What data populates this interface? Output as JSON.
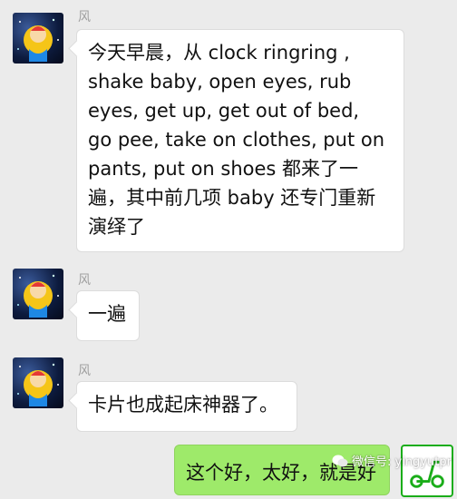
{
  "messages": [
    {
      "sender": "风",
      "lines": [
        "今天早晨，从  clock ringring ,",
        "shake baby, open eyes, rub",
        "eyes, get up, get out of bed,",
        "go pee, take on clothes, put on",
        "pants, put on shoes 都来了一",
        "遍，其中前几项 baby 还专门重新",
        "演绎了"
      ]
    },
    {
      "sender": "风",
      "lines": [
        "一遍"
      ]
    },
    {
      "sender": "风",
      "lines": [
        "卡片也成起床神器了。"
      ]
    }
  ],
  "self_message": {
    "text": "这个好，太好，就是好"
  },
  "watermark": {
    "text": "微信号: yingyutpr"
  },
  "colors": {
    "background": "#ebebeb",
    "self_bubble": "#9eea6a",
    "other_bubble": "#ffffff"
  }
}
